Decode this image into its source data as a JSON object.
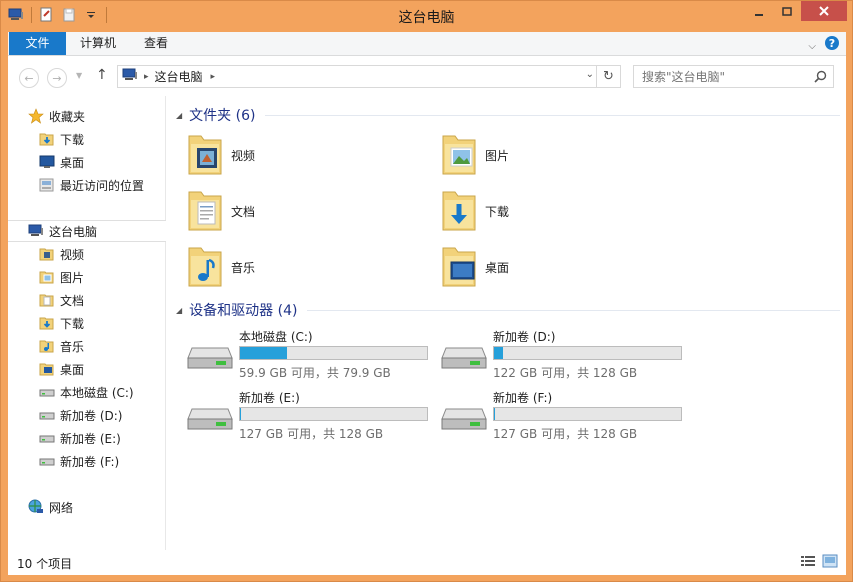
{
  "window": {
    "title": "这台电脑"
  },
  "ribbon": {
    "tabs": [
      {
        "label": "文件"
      },
      {
        "label": "计算机"
      },
      {
        "label": "查看"
      }
    ]
  },
  "address": {
    "crumb": "这台电脑"
  },
  "search": {
    "placeholder": "搜索\"这台电脑\""
  },
  "sidebar": {
    "items": [
      {
        "label": "收藏夹",
        "icon": "star-icon"
      },
      {
        "label": "下载",
        "icon": "downloads-folder-icon"
      },
      {
        "label": "桌面",
        "icon": "desktop-icon"
      },
      {
        "label": "最近访问的位置",
        "icon": "recent-places-icon"
      },
      {
        "label": "这台电脑",
        "icon": "computer-icon"
      },
      {
        "label": "视频",
        "icon": "videos-folder-icon"
      },
      {
        "label": "图片",
        "icon": "pictures-folder-icon"
      },
      {
        "label": "文档",
        "icon": "documents-folder-icon"
      },
      {
        "label": "下载",
        "icon": "downloads-folder-icon"
      },
      {
        "label": "音乐",
        "icon": "music-folder-icon"
      },
      {
        "label": "桌面",
        "icon": "desktop-icon"
      },
      {
        "label": "本地磁盘 (C:)",
        "icon": "drive-icon"
      },
      {
        "label": "新加卷 (D:)",
        "icon": "drive-icon"
      },
      {
        "label": "新加卷 (E:)",
        "icon": "drive-icon"
      },
      {
        "label": "新加卷 (F:)",
        "icon": "drive-icon"
      },
      {
        "label": "网络",
        "icon": "network-icon"
      }
    ]
  },
  "groups": {
    "folders_title": "文件夹 (6)",
    "drives_title": "设备和驱动器 (4)"
  },
  "folders": [
    {
      "label": "视频"
    },
    {
      "label": "图片"
    },
    {
      "label": "文档"
    },
    {
      "label": "下载"
    },
    {
      "label": "音乐"
    },
    {
      "label": "桌面"
    }
  ],
  "drives": [
    {
      "name": "本地磁盘 (C:)",
      "info": "59.9 GB 可用，共 79.9 GB",
      "used_fraction": 0.25
    },
    {
      "name": "新加卷 (D:)",
      "info": "122 GB 可用，共 128 GB",
      "used_fraction": 0.047
    },
    {
      "name": "新加卷 (E:)",
      "info": "127 GB 可用，共 128 GB",
      "used_fraction": 0.008
    },
    {
      "name": "新加卷 (F:)",
      "info": "127 GB 可用，共 128 GB",
      "used_fraction": 0.008
    }
  ],
  "status": {
    "count": "10 个项目"
  },
  "colors": {
    "accent": "#1979ca",
    "frame": "#f3a35d",
    "drive_bar": "#26a0da",
    "group_title": "#1e3287",
    "close": "#c7504a"
  }
}
